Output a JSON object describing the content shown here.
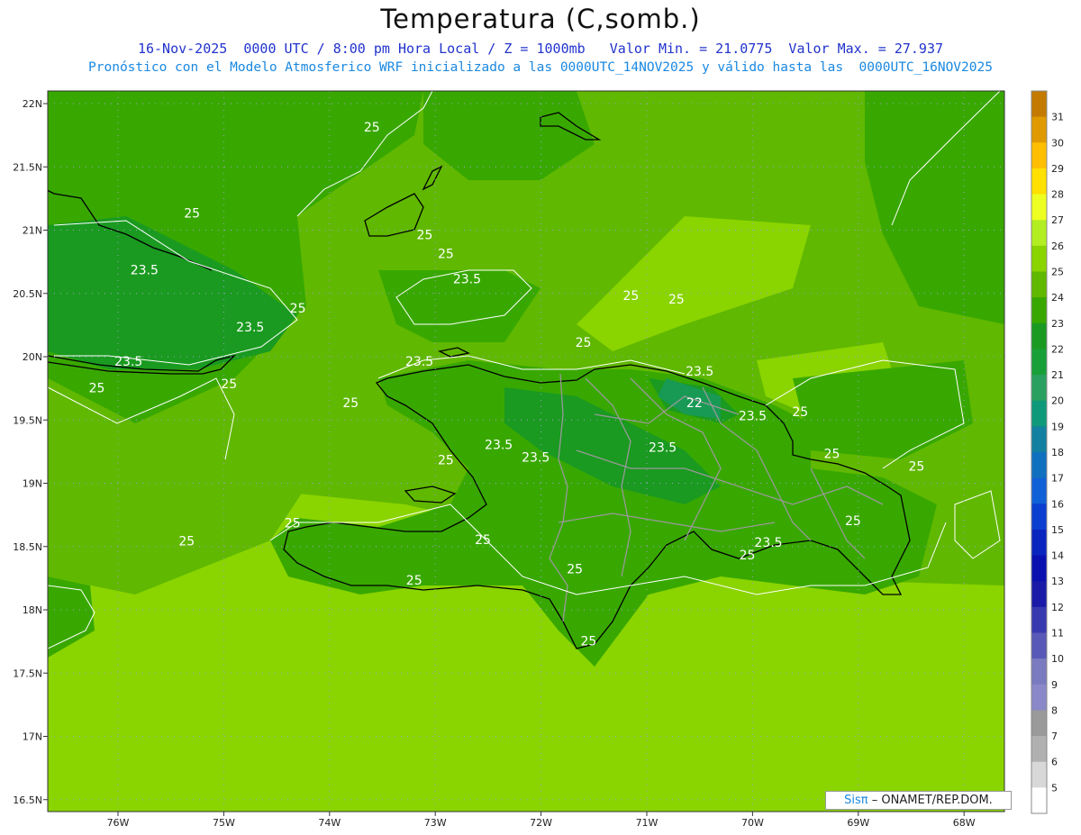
{
  "header": {
    "title": "Temperatura (C,somb.)",
    "line1": "16-Nov-2025  0000 UTC / 8:00 pm Hora Local / Z = 1000mb   Valor Min. = 21.0775  Valor Max. = 27.937",
    "line2": "Pronóstico con el Modelo Atmosferico WRF inicializado a las 0000UTC_14NOV2025 y válido hasta las  0000UTC_16NOV2025"
  },
  "map": {
    "lat_labels": [
      "22N",
      "21.5N",
      "21N",
      "20.5N",
      "20N",
      "19.5N",
      "19N",
      "18.5N",
      "18N",
      "17.5N",
      "17N",
      "16.5N"
    ],
    "lon_labels": [
      "76W",
      "75W",
      "74W",
      "73W",
      "72W",
      "71W",
      "70W",
      "69W",
      "68W"
    ],
    "grid": true,
    "contour_labels": [
      {
        "text": "25",
        "lon": -75.3,
        "lat": 21.1
      },
      {
        "text": "25",
        "lon": -73.6,
        "lat": 21.78
      },
      {
        "text": "25",
        "lon": -73.1,
        "lat": 20.93
      },
      {
        "text": "25",
        "lon": -72.9,
        "lat": 20.78
      },
      {
        "text": "23.5",
        "lon": -75.75,
        "lat": 20.65
      },
      {
        "text": "23.5",
        "lon": -72.7,
        "lat": 20.58
      },
      {
        "text": "25",
        "lon": -74.3,
        "lat": 20.35
      },
      {
        "text": "23.5",
        "lon": -74.75,
        "lat": 20.2
      },
      {
        "text": "23.5",
        "lon": -75.9,
        "lat": 19.93
      },
      {
        "text": "25",
        "lon": -76.2,
        "lat": 19.72
      },
      {
        "text": "25",
        "lon": -74.95,
        "lat": 19.75
      },
      {
        "text": "23.5",
        "lon": -73.15,
        "lat": 19.93
      },
      {
        "text": "25",
        "lon": -73.8,
        "lat": 19.6
      },
      {
        "text": "25",
        "lon": -71.15,
        "lat": 20.45
      },
      {
        "text": "25",
        "lon": -71.6,
        "lat": 20.08
      },
      {
        "text": "25",
        "lon": -70.72,
        "lat": 20.42
      },
      {
        "text": "23.5",
        "lon": -70.5,
        "lat": 19.85
      },
      {
        "text": "22",
        "lon": -70.55,
        "lat": 19.6
      },
      {
        "text": "23.5",
        "lon": -70.0,
        "lat": 19.5
      },
      {
        "text": "25",
        "lon": -69.55,
        "lat": 19.53
      },
      {
        "text": "23.5",
        "lon": -72.4,
        "lat": 19.27
      },
      {
        "text": "23.5",
        "lon": -72.05,
        "lat": 19.17
      },
      {
        "text": "23.5",
        "lon": -70.85,
        "lat": 19.25
      },
      {
        "text": "25",
        "lon": -72.9,
        "lat": 19.15
      },
      {
        "text": "25",
        "lon": -69.25,
        "lat": 19.2
      },
      {
        "text": "25",
        "lon": -68.45,
        "lat": 19.1
      },
      {
        "text": "25",
        "lon": -74.35,
        "lat": 18.65
      },
      {
        "text": "25",
        "lon": -75.35,
        "lat": 18.51
      },
      {
        "text": "25",
        "lon": -72.55,
        "lat": 18.52
      },
      {
        "text": "25",
        "lon": -73.2,
        "lat": 18.2
      },
      {
        "text": "25",
        "lon": -71.68,
        "lat": 18.29
      },
      {
        "text": "25",
        "lon": -70.05,
        "lat": 18.4
      },
      {
        "text": "23.5",
        "lon": -69.85,
        "lat": 18.5
      },
      {
        "text": "25",
        "lon": -69.05,
        "lat": 18.67
      },
      {
        "text": "25",
        "lon": -71.55,
        "lat": 17.72
      }
    ]
  },
  "colorbar": {
    "labels": [
      "31",
      "30",
      "29",
      "28",
      "27",
      "26",
      "25",
      "24",
      "23",
      "22",
      "21",
      "20",
      "19",
      "18",
      "17",
      "16",
      "15",
      "14",
      "13",
      "12",
      "11",
      "10",
      "9",
      "8",
      "7",
      "6",
      "5"
    ],
    "colors": [
      "#c47a00",
      "#e09a00",
      "#ffbf00",
      "#ffe000",
      "#eeff22",
      "#b2ee22",
      "#8ad400",
      "#60b800",
      "#38a800",
      "#1a9a20",
      "#18a038",
      "#2aa060",
      "#0e9a7a",
      "#1280a0",
      "#1070c0",
      "#1060d8",
      "#0a3ed0",
      "#0a24c0",
      "#0a10b0",
      "#1a1aa8",
      "#3838b0",
      "#5858b8",
      "#7a7ac0",
      "#8a88c8",
      "#9a9a9a",
      "#b0b0b0",
      "#d8d8d8",
      "#ffffff"
    ]
  },
  "credit": {
    "sis": "Sisπ",
    "org": "– ONAMET/REP.DOM."
  }
}
